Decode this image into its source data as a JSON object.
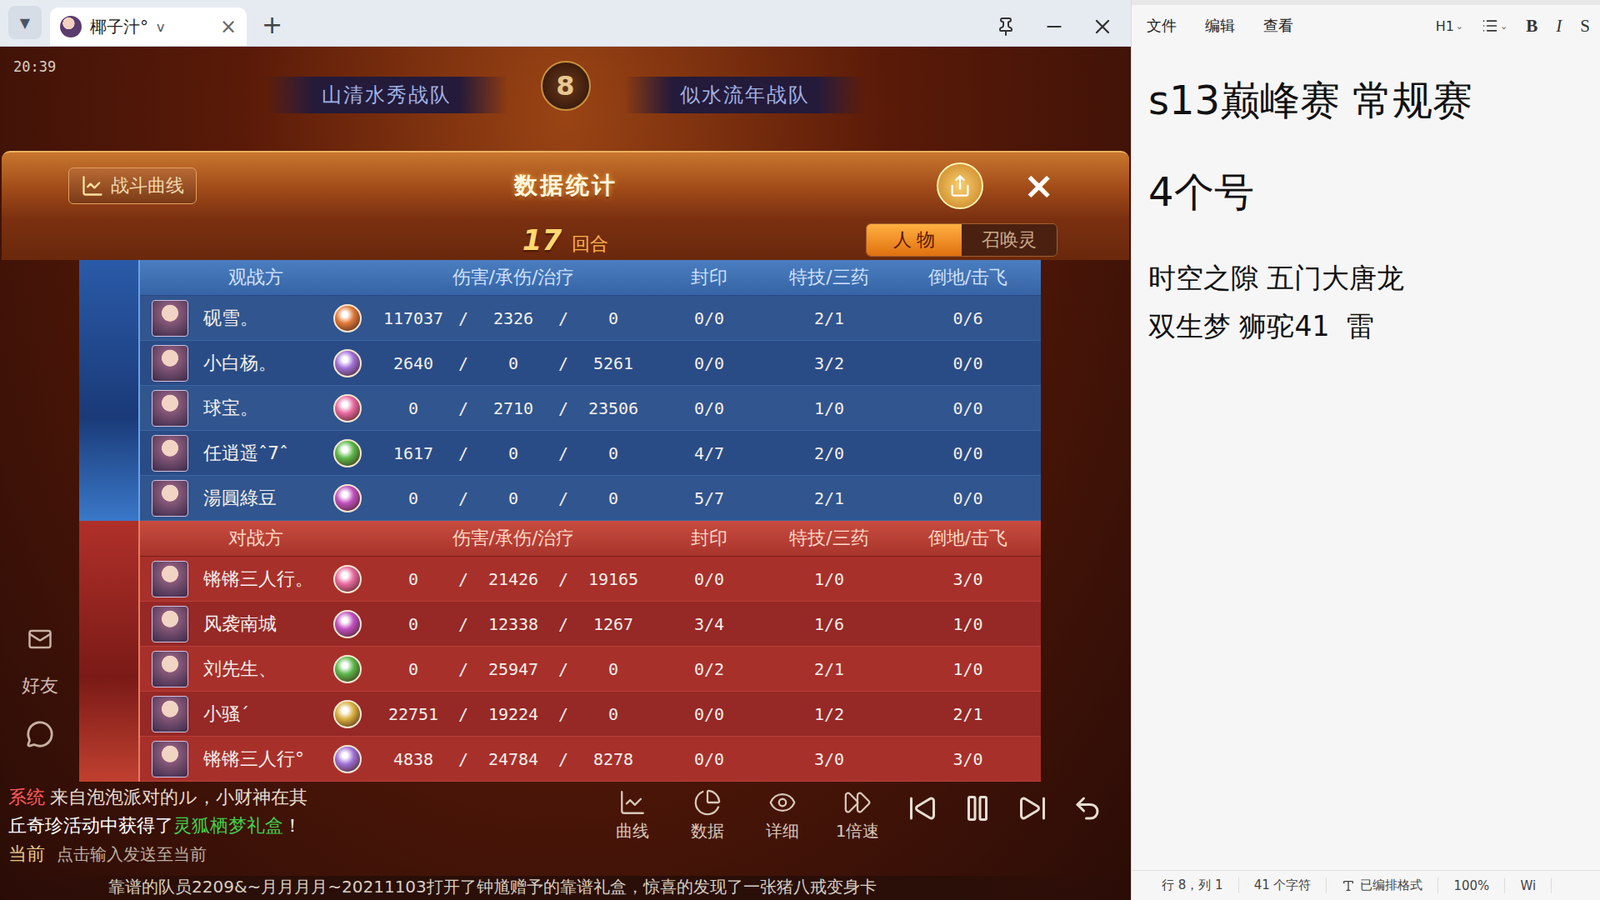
{
  "browser": {
    "menu": "▼",
    "tab": {
      "title": "椰子汁°",
      "suffix": "v",
      "close": "×",
      "selected": true
    },
    "new_tab": "+"
  },
  "game": {
    "time": "20:39",
    "teams": {
      "left": "山清水秀战队",
      "round_badge": "8",
      "right": "似水流年战队"
    },
    "sidebar": [
      {
        "label": "好友"
      }
    ],
    "stats": {
      "curve_button": "战斗曲线",
      "title": "数据统计",
      "close": "×",
      "round": "17",
      "round_unit": "回合",
      "tabs": [
        {
          "label": "人 物",
          "selected": true
        },
        {
          "label": "召唤灵",
          "selected": false
        }
      ],
      "columns": [
        "伤害/承伤/治疗",
        "封印",
        "特技/三药",
        "倒地/击飞"
      ],
      "sep": "/",
      "sides": [
        {
          "label": "观战方",
          "kind": "blue",
          "rows": [
            {
              "name": "砚雪。",
              "color": "#e07a3a",
              "damage": "117037",
              "taken": "2326",
              "heal": "0",
              "seal": "0/0",
              "skill": "2/1",
              "fall": "0/6"
            },
            {
              "name": "小白杨。",
              "color": "#a070d8",
              "damage": "2640",
              "taken": "0",
              "heal": "5261",
              "seal": "0/0",
              "skill": "3/2",
              "fall": "0/0"
            },
            {
              "name": "球宝。",
              "color": "#e86aa0",
              "damage": "0",
              "taken": "2710",
              "heal": "23506",
              "seal": "0/0",
              "skill": "1/0",
              "fall": "0/0"
            },
            {
              "name": "任逍遥ˆ7ˆ",
              "color": "#5cb84a",
              "damage": "1617",
              "taken": "0",
              "heal": "0",
              "seal": "4/7",
              "skill": "2/0",
              "fall": "0/0"
            },
            {
              "name": "湯圓綠豆",
              "color": "#c050c0",
              "damage": "0",
              "taken": "0",
              "heal": "0",
              "seal": "5/7",
              "skill": "2/1",
              "fall": "0/0"
            }
          ]
        },
        {
          "label": "对战方",
          "kind": "red",
          "rows": [
            {
              "name": "锵锵三人行。",
              "color": "#e86aa0",
              "damage": "0",
              "taken": "21426",
              "heal": "19165",
              "seal": "0/0",
              "skill": "1/0",
              "fall": "3/0"
            },
            {
              "name": "风袭南城",
              "color": "#c050c0",
              "damage": "0",
              "taken": "12338",
              "heal": "1267",
              "seal": "3/4",
              "skill": "1/6",
              "fall": "1/0"
            },
            {
              "name": "刘先生、",
              "color": "#5cb84a",
              "damage": "0",
              "taken": "25947",
              "heal": "0",
              "seal": "0/2",
              "skill": "2/1",
              "fall": "1/0"
            },
            {
              "name": "小骚´",
              "color": "#d8b040",
              "damage": "22751",
              "taken": "19224",
              "heal": "0",
              "seal": "0/0",
              "skill": "1/2",
              "fall": "2/1"
            },
            {
              "name": "锵锵三人行°",
              "color": "#a070d8",
              "damage": "4838",
              "taken": "24784",
              "heal": "8278",
              "seal": "0/0",
              "skill": "3/0",
              "fall": "3/0"
            }
          ]
        }
      ]
    },
    "chat": [
      {
        "tag": "系统",
        "parts": [
          {
            "text": "来自泡泡派对的ル，小财神在其",
            "color": "#e8dccb"
          }
        ]
      },
      {
        "parts": [
          {
            "text": "丘奇珍活动中获得了",
            "color": "#ffffff"
          },
          {
            "text": "灵狐栖梦礼盒",
            "color": "#3fd24a"
          },
          {
            "text": "！",
            "color": "#ffffff"
          }
        ]
      }
    ],
    "input": {
      "channel": "当前",
      "placeholder": "点击输入发送至当前"
    },
    "controls": [
      {
        "label": "曲线",
        "kind": "curve"
      },
      {
        "label": "数据",
        "kind": "data"
      },
      {
        "label": "详细",
        "kind": "detail"
      },
      {
        "label": "1倍速",
        "kind": "speed"
      }
    ],
    "playback": [
      {
        "kind": "prev"
      },
      {
        "kind": "pause"
      },
      {
        "kind": "next"
      },
      {
        "kind": "back"
      }
    ],
    "ticker": "靠谱的队员2209&~月月月月~20211103打开了钟馗赠予的靠谱礼盒，惊喜的发现了一张猪八戒变身卡"
  },
  "editor": {
    "menu": [
      "文件",
      "编辑",
      "查看"
    ],
    "toolbar": {
      "heading": "H1",
      "bold": "B",
      "italic": "I",
      "strike": "S"
    },
    "content": [
      {
        "text": "s13巅峰赛 常规赛",
        "kind": "h1"
      },
      {
        "text": "4个号",
        "kind": "h1"
      },
      {
        "text": "时空之隙 五门大唐龙",
        "kind": "p"
      },
      {
        "text": "双生梦 狮驼41  雷",
        "kind": "p"
      }
    ],
    "status": [
      {
        "text": "行 8，列 1",
        "kind": "plain"
      },
      {
        "text": "41 个字符",
        "kind": "plain"
      },
      {
        "text": "已编排格式",
        "kind": "format"
      },
      {
        "text": "100%",
        "kind": "plain"
      },
      {
        "text": "Wi",
        "kind": "plain"
      }
    ]
  }
}
